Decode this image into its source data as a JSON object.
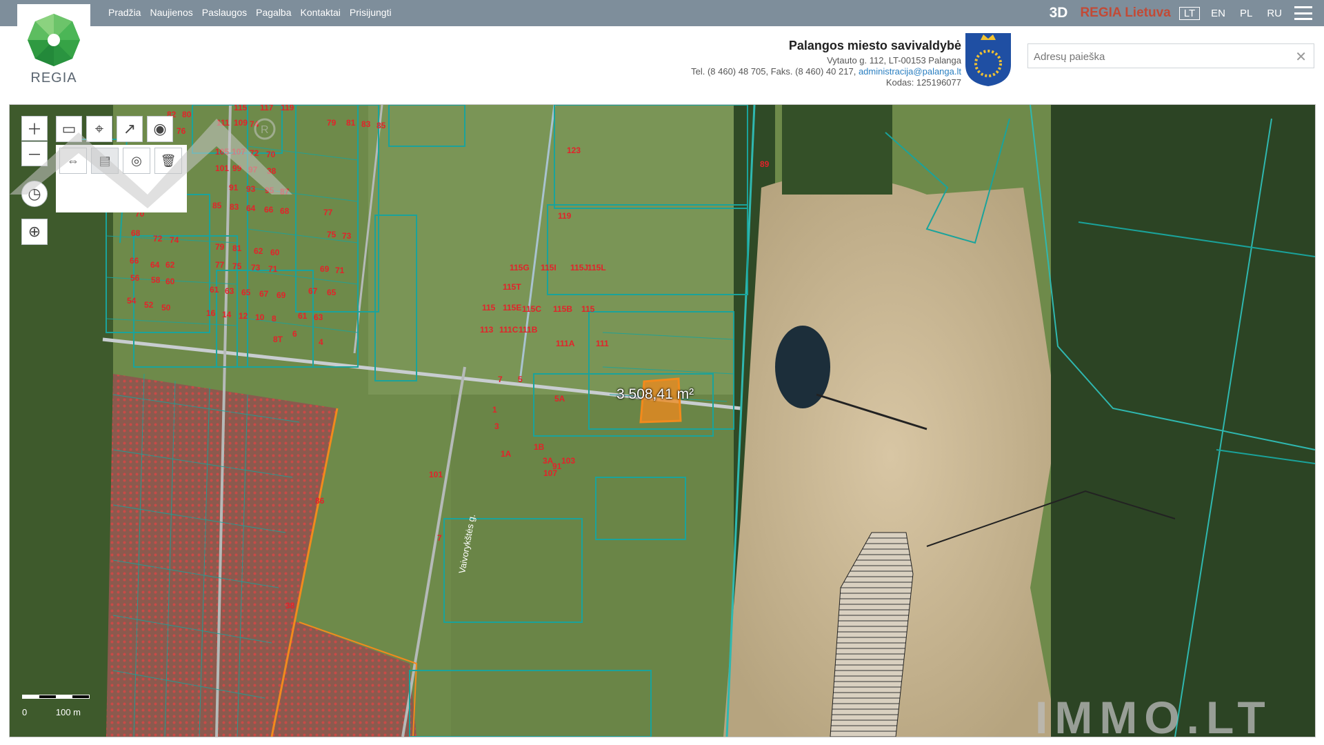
{
  "nav": {
    "items": [
      "Pradžia",
      "Naujienos",
      "Paslaugos",
      "Pagalba",
      "Kontaktai",
      "Prisijungti"
    ]
  },
  "topright": {
    "mode_3d": "3D",
    "regia_link": "REGIA Lietuva",
    "langs": [
      "LT",
      "EN",
      "PL",
      "RU"
    ],
    "active_lang": "LT"
  },
  "logo": {
    "text": "REGIA"
  },
  "municipality": {
    "name": "Palangos miesto savivaldybė",
    "address": "Vytauto g. 112, LT-00153 Palanga",
    "contacts_prefix": "Tel. (8 460) 48 705, Faks. (8 460) 40 217,",
    "email": "administracija@palanga.lt",
    "code": "Kodas: 125196077"
  },
  "search": {
    "placeholder": "Adresų paieška"
  },
  "map": {
    "measurement": "3 508,41 m²",
    "scale_labels": [
      "0",
      "100 m"
    ],
    "watermark": "IMMO.LT",
    "parcel_labels": [
      "82",
      "80",
      "76",
      "115",
      "117",
      "119",
      "111",
      "109",
      "74",
      "79",
      "81",
      "83",
      "85",
      "123",
      "105",
      "107",
      "72",
      "70",
      "101",
      "99",
      "97",
      "38",
      "89",
      "91",
      "93",
      "95",
      "87",
      "85",
      "83",
      "64",
      "66",
      "68",
      "119",
      "70",
      "77",
      "68",
      "72",
      "74",
      "75",
      "73",
      "79",
      "81",
      "62",
      "60",
      "66",
      "64",
      "62",
      "77",
      "75",
      "73",
      "71",
      "69",
      "71",
      "56",
      "58",
      "60",
      "61",
      "63",
      "65",
      "67",
      "69",
      "67",
      "65",
      "115G",
      "115I",
      "115J",
      "115L",
      "54",
      "52",
      "50",
      "16",
      "14",
      "12",
      "10",
      "8",
      "61",
      "63",
      "115T",
      "115",
      "115E",
      "115C",
      "115B",
      "115",
      "6",
      "4",
      "8T",
      "113",
      "111C",
      "111B",
      "111A",
      "111",
      "7",
      "5",
      "5A",
      "1",
      "3",
      "1A",
      "1B",
      "3A",
      "107",
      "91",
      "103",
      "101",
      "86",
      "7",
      "38"
    ],
    "street_labels": [
      "Vaivorykštės g."
    ]
  },
  "colors": {
    "topbar": "#7e8e9b",
    "regia_red": "#c24a36",
    "parcel_outline": "#1aa39b",
    "parcel_label": "#e3222a",
    "selection": "#f28a1c",
    "link": "#2a7fc1"
  }
}
